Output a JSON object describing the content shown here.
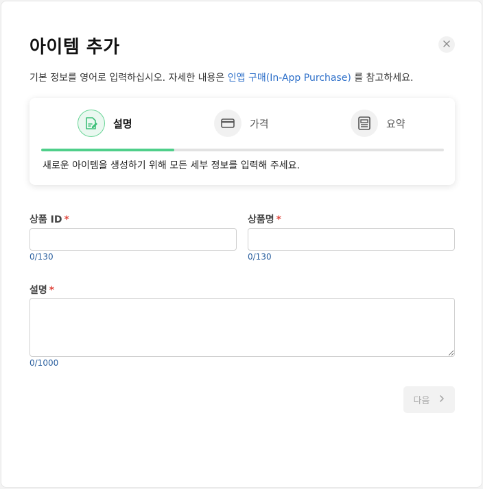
{
  "dialog": {
    "title": "아이템 추가",
    "close_icon": "close-icon",
    "subtitle_before": "기본 정보를 영어로 입력하십시오. 자세한 내용은 ",
    "subtitle_link": "인앱 구매(In-App Purchase)",
    "subtitle_after": " 를 참고하세요.",
    "link_color": "#2d6fc9"
  },
  "stepper": {
    "steps": [
      {
        "label": "설명",
        "icon": "document-edit-icon",
        "active": true
      },
      {
        "label": "가격",
        "icon": "credit-card-icon",
        "active": false
      },
      {
        "label": "요약",
        "icon": "summary-list-icon",
        "active": false
      }
    ],
    "progress_fraction": 0.33,
    "progress_color": "#4fcf8a",
    "description": "새로운 아이템을 생성하기 위해 모든 세부 정보를 입력해 주세요."
  },
  "form": {
    "product_id": {
      "label": "상품 ID",
      "required_mark": "*",
      "value": "",
      "counter": "0/130"
    },
    "product_name": {
      "label": "상품명",
      "required_mark": "*",
      "value": "",
      "counter": "0/130"
    },
    "description": {
      "label": "설명",
      "required_mark": "*",
      "value": "",
      "counter": "0/1000"
    }
  },
  "footer": {
    "next_label": "다음",
    "next_icon": "chevron-right-icon",
    "next_disabled": true
  }
}
